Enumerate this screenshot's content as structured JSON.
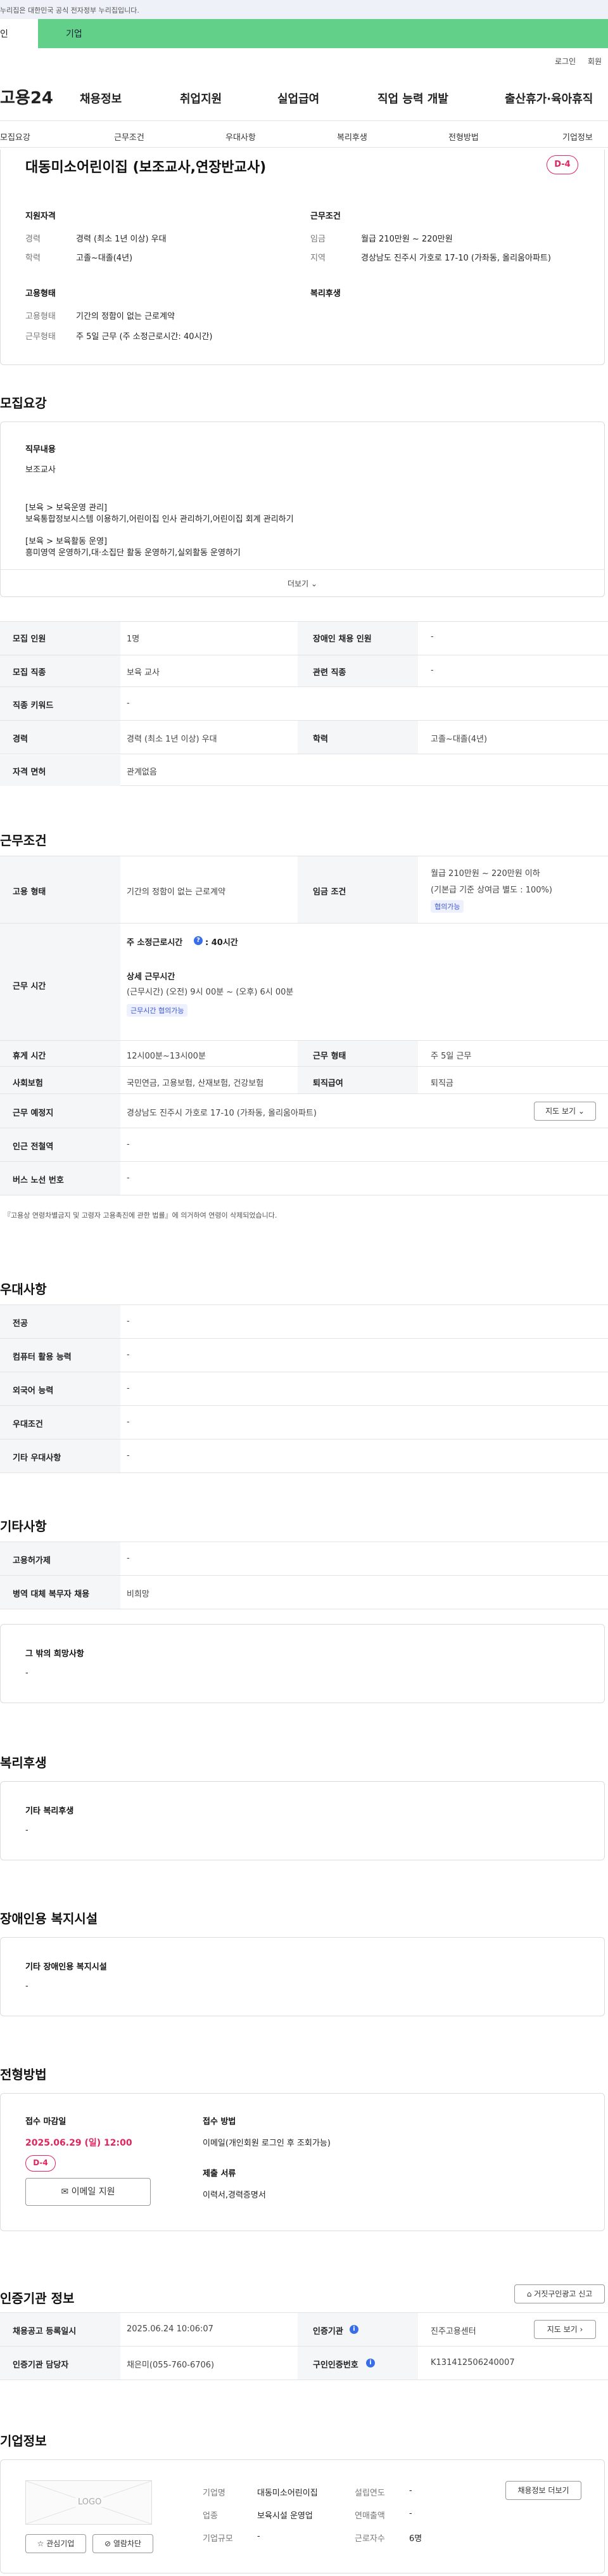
{
  "banner": {
    "text": "누리집은 대한민국 공식 전자정부 누리집입니다."
  },
  "tabs": {
    "left": "인",
    "active": "기업"
  },
  "toplinks": {
    "login": "로그인",
    "join": "회원"
  },
  "site": {
    "logo": "고용24"
  },
  "gnb": [
    "채용정보",
    "취업지원",
    "실업급여",
    "직업 능력 개발",
    "출산휴가·육아휴직"
  ],
  "subnav": [
    "모집요강",
    "근무조건",
    "우대사항",
    "복리후생",
    "전형방법",
    "기업정보"
  ],
  "job": {
    "title": "대동미소어린이집 (보조교사,연장반교사)",
    "dday": "D-4"
  },
  "summary": {
    "qual_title": "지원자격",
    "career_k": "경력",
    "career_v": "경력 (최소 1년 이상) 우대",
    "edu_k": "학력",
    "edu_v": "고졸~대졸(4년)",
    "cond_title": "근무조건",
    "wage_k": "임금",
    "wage_v": "월급 210만원 ~ 220만원",
    "area_k": "지역",
    "area_v": "경상남도 진주시 가호로 17-10 (가좌동, 올리움아파트)",
    "emp_title": "고용형태",
    "type_k": "고용형태",
    "type_v": "기간의 정함이 없는 근로계약",
    "form_k": "근무형태",
    "form_v": "주 5일 근무 (주 소정근로시간: 40시간)",
    "welfare_title": "복리후생"
  },
  "recruit": {
    "section": "모집요강",
    "duty_title": "직무내용",
    "duty_lines": [
      "보조교사",
      "",
      "[보육 > 보육운영 관리]",
      "보육통합정보시스템 이용하기,어린이집 인사 관리하기,어린이집 회계 관리하기",
      "",
      "[보육 > 보육활동 운영]",
      "흥미영역 운영하기,대·소집단 활동 운영하기,실외활동 운영하기"
    ],
    "more": "더보기",
    "table": [
      {
        "k1": "모집 인원",
        "v1": "1명",
        "k2": "장애인 채용 인원",
        "v2": "-"
      },
      {
        "k1": "모집 직종",
        "v1": "보육 교사",
        "k2": "관련 직종",
        "v2": "-"
      },
      {
        "k1": "직종 키워드",
        "v1": "-"
      },
      {
        "k1": "경력",
        "v1": "경력 (최소 1년 이상) 우대",
        "k2": "학력",
        "v2": "고졸~대졸(4년)"
      },
      {
        "k1": "자격 면허",
        "v1": "관계없음"
      }
    ]
  },
  "work": {
    "section": "근무조건",
    "type_k": "고용 형태",
    "type_v": "기간의 정함이 없는 근로계약",
    "wage_k": "임금 조건",
    "wage_v1": "월급 210만원 ~ 220만원 이하",
    "wage_v2": "(기본급 기준 상여금 별도 : 100%)",
    "wage_tag": "협의가능",
    "time_k": "근무 시간",
    "time_week": "주 소정근로시간",
    "time_week_v": ": 40시간",
    "time_detail": "상세 근무시간",
    "time_detail_v": "(근무시간) (오전) 9시 00분 ~ (오후) 6시 00분",
    "time_tag": "근무시간 협의가능",
    "rest_k": "휴게 시간",
    "rest_v": "12시00분~13시00분",
    "form_k": "근무 형태",
    "form_v": "주 5일 근무",
    "ins_k": "사회보험",
    "ins_v": "국민연금, 고용보험, 산재보험, 건강보험",
    "sev_k": "퇴직급여",
    "sev_v": "퇴직금",
    "place_k": "근무 예정지",
    "place_v": "경상남도 진주시 가호로 17-10 (가좌동, 올리움아파트)",
    "map_btn": "지도 보기",
    "station_k": "인근 전철역",
    "station_v": "-",
    "bus_k": "버스 노선 번호",
    "bus_v": "-",
    "note": "『고용상 연령차별금지 및 고령자 고용촉진에 관한 법률』에 의거하여 연령이 삭제되었습니다."
  },
  "pref": {
    "section": "우대사항",
    "rows": [
      {
        "k": "전공",
        "v": "-"
      },
      {
        "k": "컴퓨터 활용 능력",
        "v": "-"
      },
      {
        "k": "외국어 능력",
        "v": "-"
      },
      {
        "k": "우대조건",
        "v": "-"
      },
      {
        "k": "기타 우대사항",
        "v": "-"
      }
    ]
  },
  "etc": {
    "section": "기타사항",
    "rows": [
      {
        "k": "고용허가제",
        "v": "-"
      },
      {
        "k": "병역 대체 복무자 채용",
        "v": "비희망"
      }
    ],
    "other_title": "그 밖의 희망사항",
    "other_v": "-"
  },
  "welfare": {
    "section": "복리후생",
    "title": "기타 복리후생",
    "v": "-"
  },
  "disability": {
    "section": "장애인용 복지시설",
    "title": "기타 장애인용 복지시설",
    "v": "-"
  },
  "screening": {
    "section": "전형방법",
    "deadline_title": "접수 마감일",
    "deadline": "2025.06.29 (일) 12:00",
    "dday": "D-4",
    "email_btn": "이메일 지원",
    "method_title": "접수 방법",
    "method": "이메일(개인회원 로그인 후 조회가능)",
    "docs_title": "제출 서류",
    "docs": "이력서,경력증명서"
  },
  "agency": {
    "section": "인증기관 정보",
    "report_btn": "거짓구인광고 신고",
    "reg_k": "채용공고 등록일시",
    "reg_v": "2025.06.24 10:06:07",
    "agency_k": "인증기관",
    "agency_v": "진주고용센터",
    "map_btn": "지도 보기",
    "mgr_k": "인증기관 담당자",
    "mgr_v": "채은미(055-760-6706)",
    "id_k": "구인인증번호",
    "id_v": "K131412506240007"
  },
  "company": {
    "section": "기업정보",
    "logo_text": "LOGO",
    "fav_btn": "관심기업",
    "block_btn": "열람차단",
    "name_k": "기업명",
    "name_v": "대동미소어린이집",
    "est_k": "설립연도",
    "est_v": "-",
    "ind_k": "업종",
    "ind_v": "보육시설 운영업",
    "rev_k": "연매출액",
    "rev_v": "-",
    "size_k": "기업규모",
    "size_v": "-",
    "emp_k": "근로자수",
    "emp_v": "6명",
    "more_btn": "채용정보 더보기"
  }
}
